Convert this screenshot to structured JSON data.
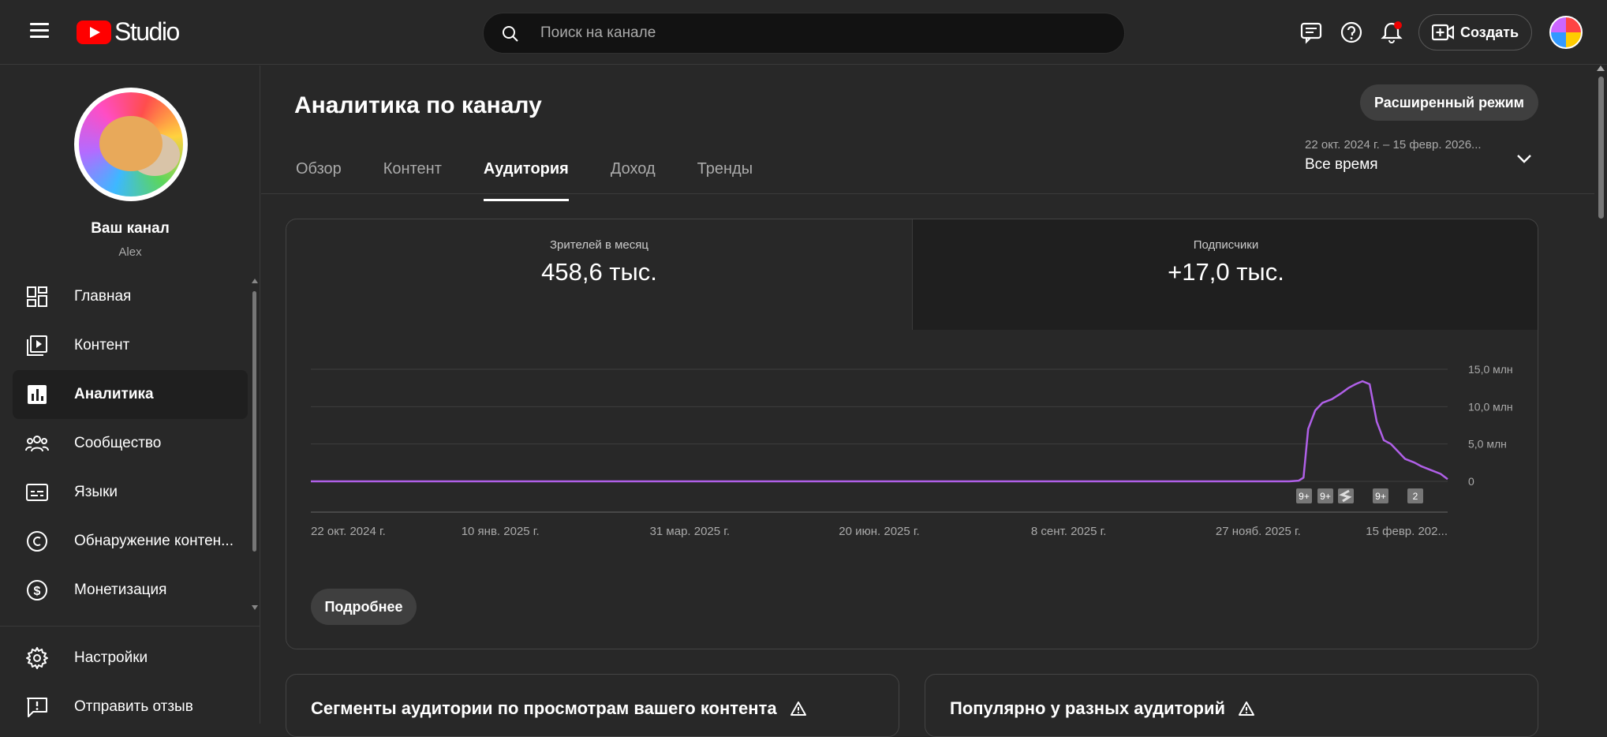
{
  "app": {
    "logo_text": "Studio"
  },
  "search": {
    "placeholder": "Поиск на канале"
  },
  "topbar": {
    "create_label": "Создать"
  },
  "sidebar": {
    "channel_title": "Ваш канал",
    "channel_owner": "Alex",
    "items": [
      {
        "label": "Главная",
        "icon": "dashboard-icon"
      },
      {
        "label": "Контент",
        "icon": "content-icon"
      },
      {
        "label": "Аналитика",
        "icon": "analytics-icon"
      },
      {
        "label": "Сообщество",
        "icon": "community-icon"
      },
      {
        "label": "Языки",
        "icon": "subtitles-icon"
      },
      {
        "label": "Обнаружение контен...",
        "icon": "copyright-icon"
      },
      {
        "label": "Монетизация",
        "icon": "monetization-icon"
      }
    ],
    "bottom_items": [
      {
        "label": "Настройки",
        "icon": "gear-icon"
      },
      {
        "label": "Отправить отзыв",
        "icon": "feedback-icon"
      }
    ]
  },
  "page": {
    "title": "Аналитика по каналу",
    "advanced_mode": "Расширенный режим",
    "tabs": [
      "Обзор",
      "Контент",
      "Аудитория",
      "Доход",
      "Тренды"
    ],
    "active_tab": "Аудитория",
    "date_range": "22 окт. 2024 г. – 15 февр. 2026...",
    "date_label": "Все время"
  },
  "metrics": {
    "monthly_viewers": {
      "label": "Зрителей в месяц",
      "value": "458,6 тыс."
    },
    "subscribers": {
      "label": "Подписчики",
      "value": "+17,0 тыс."
    }
  },
  "more_button": "Подробнее",
  "cards": {
    "segments_title": "Сегменты аудитории по просмотрам вашего контента",
    "popular_title": "Популярно у разных аудиторий"
  },
  "chart_data": {
    "type": "line",
    "color": "#b060e8",
    "y_unit": "млн",
    "y_ticks": [
      "15,0 млн",
      "10,0 млн",
      "5,0 млн",
      "0"
    ],
    "ylim": [
      0,
      15
    ],
    "x_ticks": [
      "22 окт. 2024 г.",
      "10 янв. 2025 г.",
      "31 мар. 2025 г.",
      "20 июн. 2025 г.",
      "8 сент. 2025 г.",
      "27 нояб. 2025 г.",
      "15 февр. 202..."
    ],
    "x": [
      "2024-10-22",
      "2025-12-10",
      "2025-12-14",
      "2025-12-16",
      "2025-12-18",
      "2025-12-21",
      "2025-12-24",
      "2025-12-28",
      "2026-01-01",
      "2026-01-04",
      "2026-01-07",
      "2026-01-10",
      "2026-01-13",
      "2026-01-16",
      "2026-01-19",
      "2026-01-22",
      "2026-01-25",
      "2026-01-28",
      "2026-02-01",
      "2026-02-04",
      "2026-02-08",
      "2026-02-12",
      "2026-02-15"
    ],
    "values": [
      0,
      0,
      0.1,
      0.5,
      7,
      9.5,
      10.5,
      11,
      11.8,
      12.5,
      13,
      13.4,
      13,
      8,
      5.5,
      5,
      4,
      3,
      2.5,
      2,
      1.5,
      1,
      0.3
    ],
    "markers": [
      "9+",
      "9+",
      "shorts-icon",
      "9+",
      "2"
    ]
  }
}
